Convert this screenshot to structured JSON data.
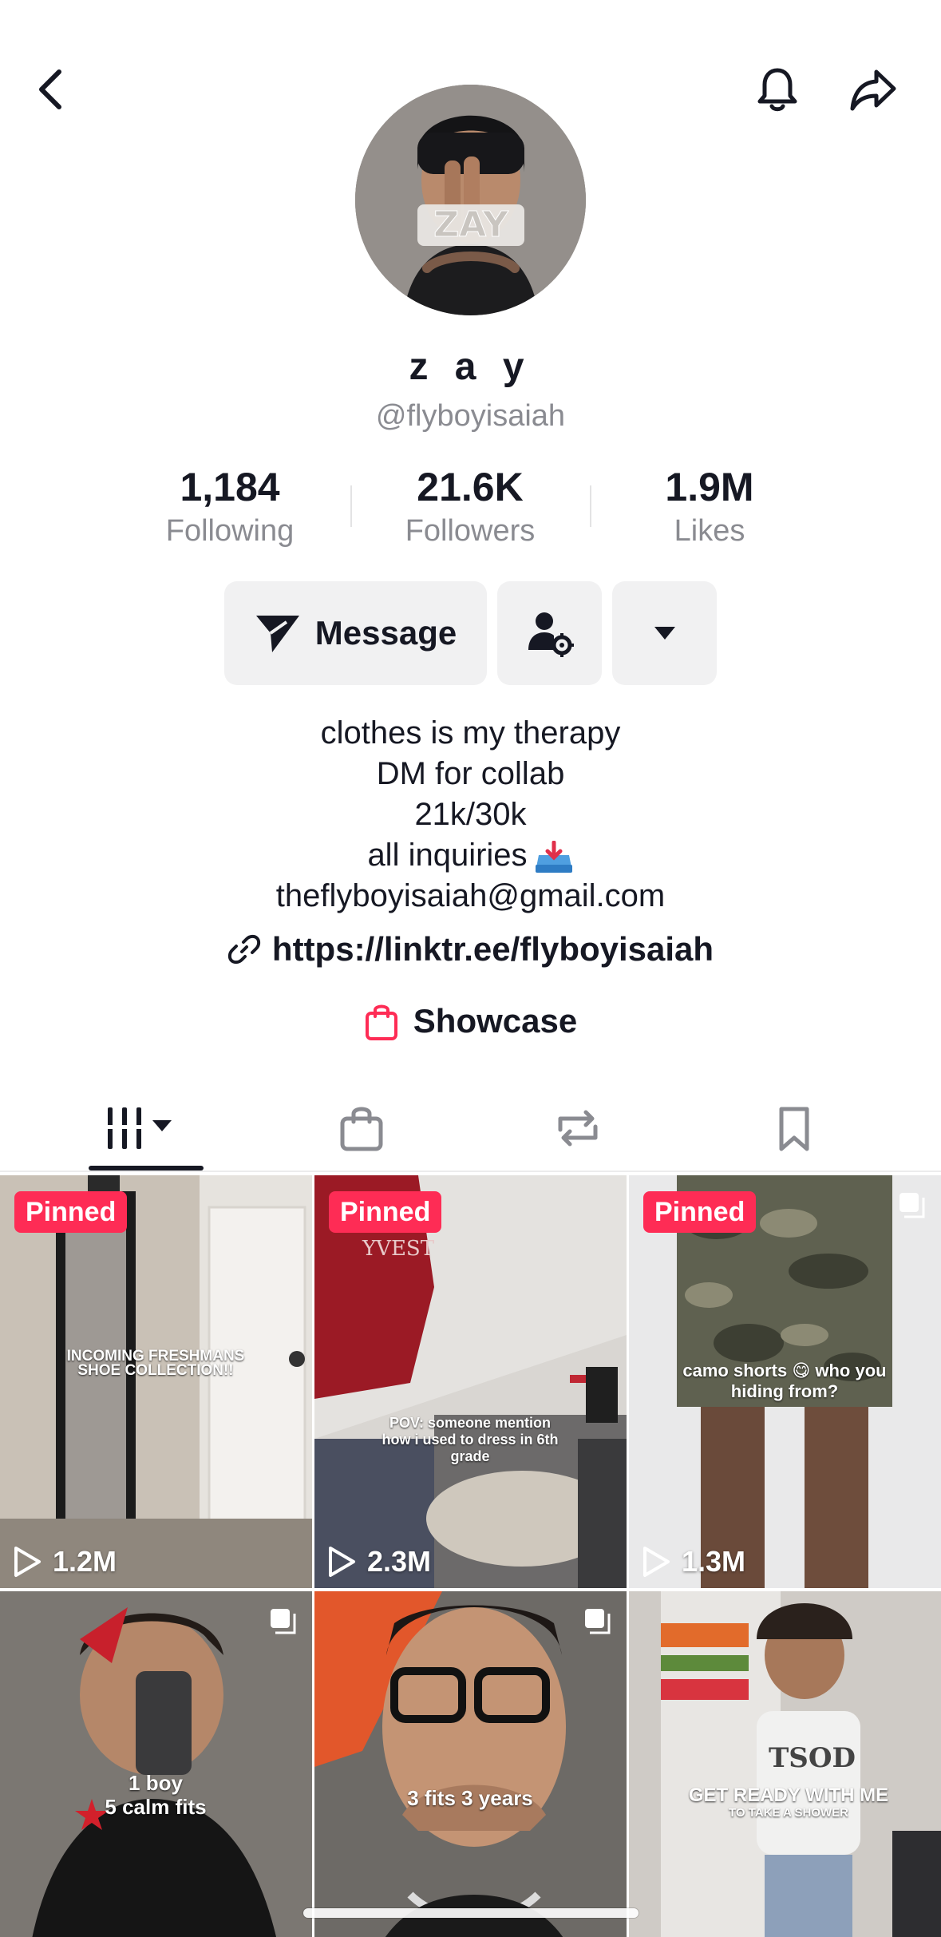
{
  "profile": {
    "display_name": "z a y",
    "handle": "@flyboyisaiah"
  },
  "stats": [
    {
      "value": "1,184",
      "label": "Following"
    },
    {
      "value": "21.6K",
      "label": "Followers"
    },
    {
      "value": "1.9M",
      "label": "Likes"
    }
  ],
  "actions": {
    "message_label": "Message"
  },
  "bio": {
    "lines": [
      "clothes is my therapy",
      "DM for collab",
      "21k/30k",
      "all inquiries",
      "theflyboyisaiah@gmail.com"
    ],
    "emoji_icon": "inbox-tray-icon"
  },
  "link": {
    "url": "https://linktr.ee/flyboyisaiah"
  },
  "showcase": {
    "label": "Showcase",
    "color": "#fe2c55"
  },
  "tabs": [
    {
      "icon": "videos-grid-icon",
      "active": true
    },
    {
      "icon": "shopping-bag-icon",
      "active": false
    },
    {
      "icon": "repost-icon",
      "active": false
    },
    {
      "icon": "bookmark-icon",
      "active": false
    }
  ],
  "videos": [
    {
      "pinned": "Pinned",
      "views": "1.2M",
      "caption": "INCOMING FRESHMANS SHOE COLLECTION!!"
    },
    {
      "pinned": "Pinned",
      "views": "2.3M",
      "caption_lines": [
        "POV: someone mention",
        "how i used to dress in 6th",
        "grade"
      ]
    },
    {
      "pinned": "Pinned",
      "views": "1.3M",
      "caption_lines": [
        "camo shorts 😋 who you",
        "hiding from?"
      ]
    },
    {
      "caption_lines": [
        "1 boy",
        "5 calm fits"
      ]
    },
    {
      "caption": "3 fits 3 years"
    },
    {
      "caption_lines": [
        "GET READY WITH ME",
        "TO TAKE A SHOWER"
      ]
    }
  ],
  "colors": {
    "accent": "#fe2c55",
    "text": "#161823",
    "secondary_text": "#8a8b91",
    "button_bg": "#f1f1f2"
  }
}
